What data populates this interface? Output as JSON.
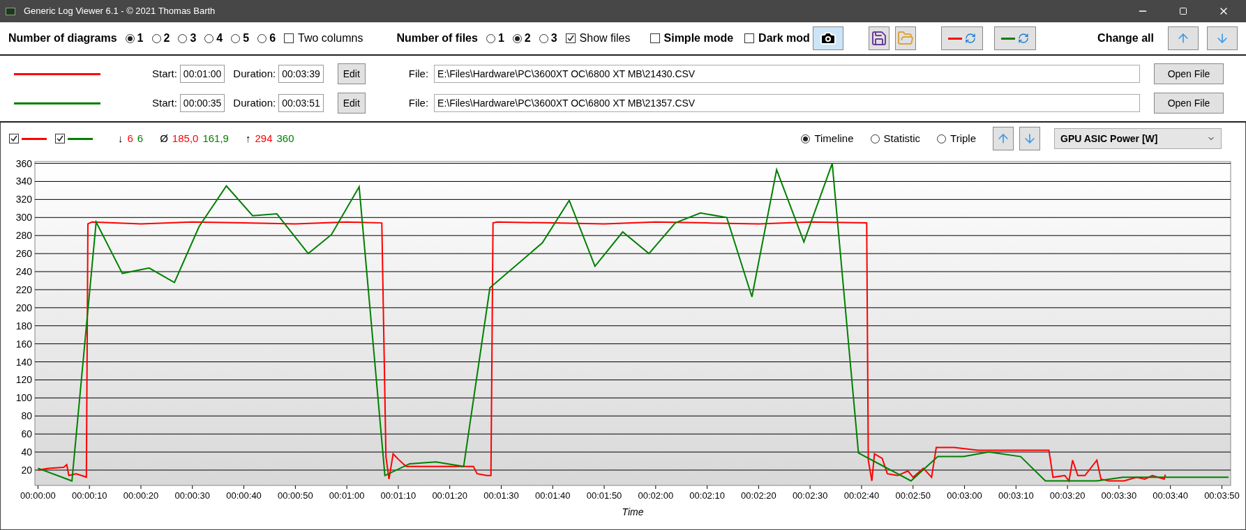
{
  "window": {
    "title": "Generic Log Viewer 6.1 - © 2021 Thomas Barth"
  },
  "toolbar": {
    "diagrams_label": "Number of diagrams",
    "diagrams": [
      {
        "label": "1",
        "selected": true
      },
      {
        "label": "2",
        "selected": false
      },
      {
        "label": "3",
        "selected": false
      },
      {
        "label": "4",
        "selected": false
      },
      {
        "label": "5",
        "selected": false
      },
      {
        "label": "6",
        "selected": false
      }
    ],
    "two_columns": {
      "label": "Two columns",
      "checked": false
    },
    "files_label": "Number of files",
    "files": [
      {
        "label": "1",
        "selected": false
      },
      {
        "label": "2",
        "selected": true
      },
      {
        "label": "3",
        "selected": false
      }
    ],
    "show_files": {
      "label": "Show files",
      "checked": true
    },
    "simple_mode": {
      "label": "Simple mode",
      "checked": false
    },
    "dark_mode": {
      "label": "Dark mod",
      "checked": false
    },
    "swap_buttons": [
      {
        "color": "#ff0000"
      },
      {
        "color": "#008000"
      }
    ],
    "change_all": "Change all"
  },
  "files": [
    {
      "color": "#ff0000",
      "start_label": "Start:",
      "start": "00:01:00",
      "duration_label": "Duration:",
      "duration": "00:03:39",
      "edit": "Edit",
      "file_label": "File:",
      "path": "E:\\Files\\Hardware\\PC\\3600XT OC\\6800 XT MB\\21430.CSV",
      "open": "Open File"
    },
    {
      "color": "#008000",
      "start_label": "Start:",
      "start": "00:00:35",
      "duration_label": "Duration:",
      "duration": "00:03:51",
      "edit": "Edit",
      "file_label": "File:",
      "path": "E:\\Files\\Hardware\\PC\\3600XT OC\\6800 XT MB\\21357.CSV",
      "open": "Open File"
    }
  ],
  "diagram": {
    "toggles": [
      {
        "color": "#ff0000",
        "checked": true
      },
      {
        "color": "#008000",
        "checked": true
      }
    ],
    "stats": [
      {
        "symbol": "↓",
        "values": [
          "6",
          "6"
        ]
      },
      {
        "symbol": "Ø",
        "values": [
          "185,0",
          "161,9"
        ]
      },
      {
        "symbol": "↑",
        "values": [
          "294",
          "360"
        ]
      }
    ],
    "views": [
      {
        "label": "Timeline",
        "selected": true
      },
      {
        "label": "Statistic",
        "selected": false
      },
      {
        "label": "Triple",
        "selected": false
      }
    ],
    "channel": "GPU ASIC Power [W]",
    "chart_data": {
      "type": "line",
      "grid": true,
      "xlabel": "Time",
      "xlim": [
        -0.6,
        231.7
      ],
      "ylim": [
        3,
        362
      ],
      "xticks": [
        {
          "value": 0,
          "label": "00:00:00"
        },
        {
          "value": 10,
          "label": "00:00:10"
        },
        {
          "value": 20,
          "label": "00:00:20"
        },
        {
          "value": 30,
          "label": "00:00:30"
        },
        {
          "value": 40,
          "label": "00:00:40"
        },
        {
          "value": 50,
          "label": "00:00:50"
        },
        {
          "value": 60,
          "label": "00:01:00"
        },
        {
          "value": 70,
          "label": "00:01:10"
        },
        {
          "value": 80,
          "label": "00:01:20"
        },
        {
          "value": 90,
          "label": "00:01:30"
        },
        {
          "value": 100,
          "label": "00:01:40"
        },
        {
          "value": 110,
          "label": "00:01:50"
        },
        {
          "value": 120,
          "label": "00:02:00"
        },
        {
          "value": 130,
          "label": "00:02:10"
        },
        {
          "value": 140,
          "label": "00:02:20"
        },
        {
          "value": 150,
          "label": "00:02:30"
        },
        {
          "value": 160,
          "label": "00:02:40"
        },
        {
          "value": 170,
          "label": "00:02:50"
        },
        {
          "value": 180,
          "label": "00:03:00"
        },
        {
          "value": 190,
          "label": "00:03:10"
        },
        {
          "value": 200,
          "label": "00:03:20"
        },
        {
          "value": 210,
          "label": "00:03:30"
        },
        {
          "value": 220,
          "label": "00:03:40"
        },
        {
          "value": 230,
          "label": "00:03:50"
        }
      ],
      "yticks": [
        20,
        40,
        60,
        80,
        100,
        120,
        140,
        160,
        180,
        200,
        220,
        240,
        260,
        280,
        300,
        320,
        340,
        360
      ],
      "series": [
        {
          "color": "#ff0000",
          "x": [
            0,
            2,
            5,
            5.6,
            6,
            7.4,
            9,
            9.4,
            9.7,
            10.5,
            20,
            30,
            40,
            50,
            60,
            66.8,
            67.6,
            68.2,
            69,
            70,
            71.5,
            80.7,
            84.6,
            85.3,
            87.2,
            88,
            88.4,
            89.2,
            100,
            110,
            120,
            130,
            140,
            150,
            161,
            161.3,
            162,
            162.5,
            164,
            165,
            167,
            169,
            170,
            172,
            173.6,
            174.5,
            178,
            182.6,
            196.4,
            197.2,
            199.5,
            200.3,
            201,
            202,
            203.4,
            205.7,
            206.5,
            208,
            211,
            213.4,
            215,
            216.5,
            218.8,
            219
          ],
          "values": [
            20,
            22,
            23,
            26,
            14,
            16,
            13,
            12,
            293,
            295,
            293,
            295,
            294,
            293,
            295,
            294,
            35,
            10,
            38,
            32,
            24,
            24,
            24,
            16,
            14,
            14,
            294,
            295,
            294,
            293,
            295,
            294,
            293,
            295,
            294,
            31,
            8,
            38,
            33,
            16,
            14,
            19,
            12,
            22,
            12,
            45,
            45,
            42,
            42,
            12,
            14,
            8,
            31,
            14,
            14,
            31,
            10,
            8,
            8,
            12,
            10,
            14,
            10,
            15
          ]
        },
        {
          "color": "#008000",
          "x": [
            0,
            6.6,
            11.3,
            16.4,
            21.6,
            26.5,
            31.3,
            36.6,
            41.7,
            46.4,
            52.5,
            57,
            62.4,
            67.4,
            72.2,
            77.3,
            82.7,
            87.8,
            98,
            103.2,
            108.2,
            113.6,
            118.7,
            123.8,
            128.7,
            133.8,
            138.7,
            143.5,
            148.8,
            154.3,
            159.4,
            169.6,
            174.8,
            179.8,
            184.7,
            190.9,
            195.7,
            205.7,
            210.8,
            231.3
          ],
          "values": [
            22,
            8,
            295,
            238,
            244,
            228,
            290,
            335,
            302,
            304,
            260,
            281,
            334,
            14,
            27,
            29,
            24,
            222,
            272,
            319,
            246,
            284,
            260,
            294,
            305,
            300,
            212,
            353,
            273,
            360,
            39,
            8,
            35,
            35,
            40,
            35,
            8,
            8,
            12,
            12
          ]
        }
      ]
    }
  }
}
